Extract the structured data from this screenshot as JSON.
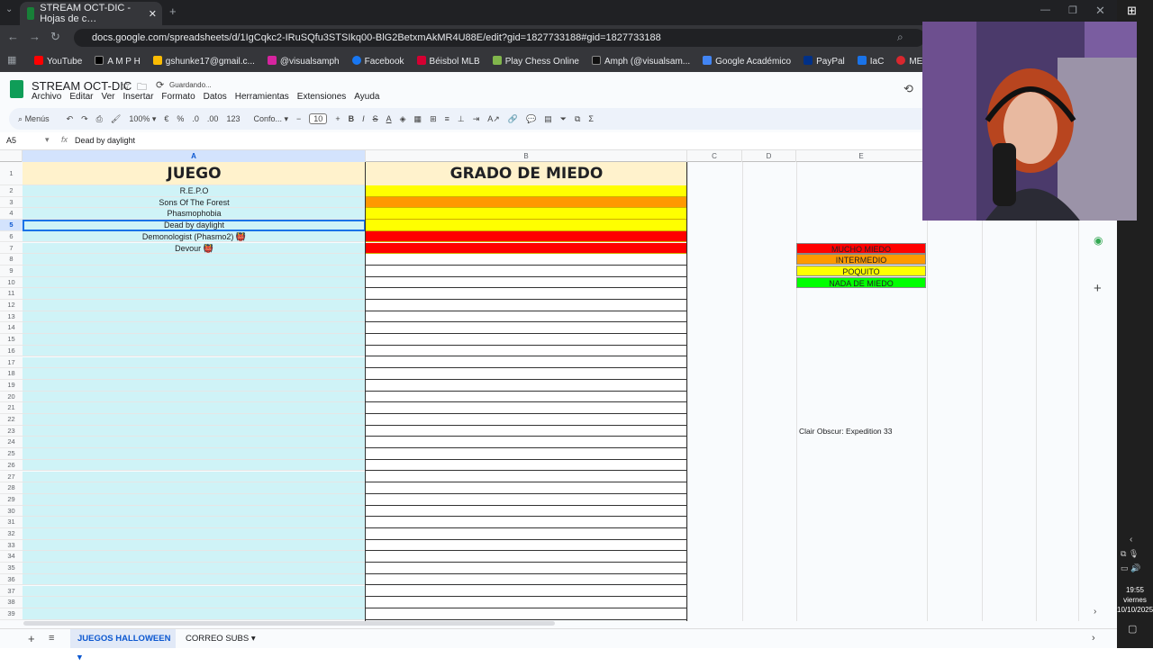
{
  "browser": {
    "tab_title": "STREAM OCT-DIC - Hojas de c…",
    "url": "docs.google.com/spreadsheets/d/1IgCqkc2-IRuSQfu3STSIkq00-BlG2BetxmAkMR4U88E/edit?gid=1827733188#gid=1827733188",
    "bookmarks": [
      "YouTube",
      "A M P H",
      "gshunke17@gmail.c...",
      "@visualsamph",
      "Facebook",
      "Béisbol MLB",
      "Play Chess Online",
      "Amph (@visualsam...",
      "Google Académico",
      "PayPal",
      "IaC",
      "MEGA"
    ]
  },
  "doc": {
    "title": "STREAM OCT-DIC",
    "status": "Guardando...",
    "menus": [
      "Archivo",
      "Editar",
      "Ver",
      "Insertar",
      "Formato",
      "Datos",
      "Herramientas",
      "Extensiones",
      "Ayuda"
    ]
  },
  "toolbar": {
    "search_label": "Menús",
    "zoom": "100%",
    "currency": "€",
    "percent": "%",
    "dec_minus": ".0",
    "dec_plus": ".00",
    "numfmt": "123",
    "font": "Confo...",
    "font_size": "10"
  },
  "formula": {
    "cell_ref": "A5",
    "content": "Dead by daylight"
  },
  "columns": [
    "A",
    "B",
    "C",
    "D",
    "E"
  ],
  "sheet": {
    "header_a": "JUEGO",
    "header_b": "GRADO DE MIEDO",
    "games": [
      "R.E.P.O",
      "Sons Of The Forest",
      "Phasmophobia",
      "Dead by daylight",
      "Demonologist (Phasmo2) 👹",
      "Devour 👹"
    ],
    "fear_colors": [
      "#ffff00",
      "#ff9900",
      "#ffff00",
      "#ffff00",
      "#ff0000",
      "#ff0000"
    ],
    "row_numbers": [
      "1",
      "2",
      "3",
      "4",
      "5",
      "6",
      "7",
      "8",
      "9",
      "10",
      "11",
      "12",
      "13",
      "14",
      "15",
      "16",
      "17",
      "18",
      "19",
      "20",
      "21",
      "22",
      "23",
      "24",
      "25",
      "26",
      "27",
      "28",
      "29",
      "30",
      "31",
      "32",
      "33",
      "34",
      "35",
      "36",
      "37",
      "38",
      "39"
    ],
    "legend": [
      {
        "label": "MUCHO MIEDO",
        "color": "#ff0000"
      },
      {
        "label": "INTERMEDIO",
        "color": "#ff9900"
      },
      {
        "label": "POQUITO",
        "color": "#ffff00"
      },
      {
        "label": "NADA DE MIEDO",
        "color": "#00ff00"
      }
    ],
    "note_e23": "Clair Obscur: Expedition 33"
  },
  "sheet_tabs": [
    "JUEGOS HALLOWEEN",
    "CORREO SUBS"
  ],
  "taskbar": {
    "time": "19:55",
    "day": "viernes",
    "date": "10/10/2025"
  }
}
